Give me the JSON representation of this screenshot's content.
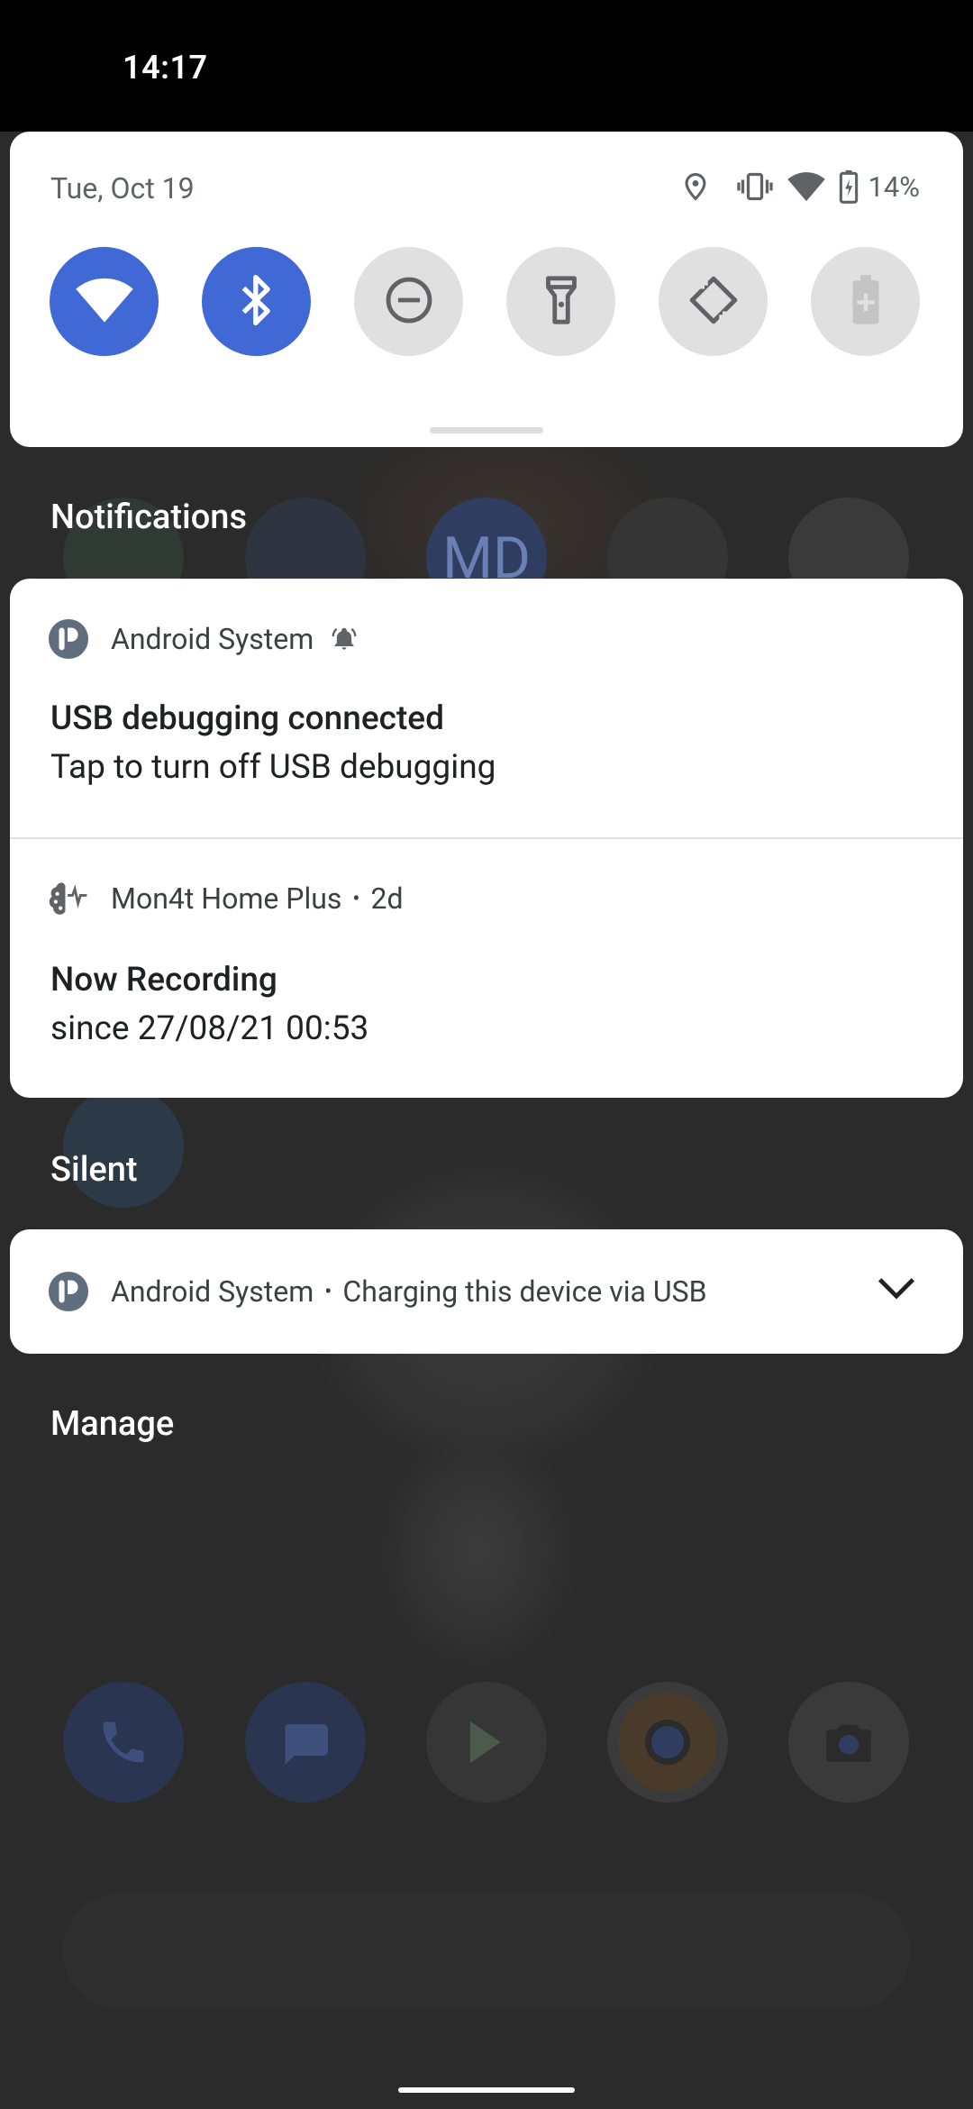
{
  "status_bar": {
    "time": "14:17"
  },
  "quick_settings": {
    "date": "Tue, Oct 19",
    "battery": "14%",
    "tiles": [
      {
        "id": "wifi",
        "icon": "wifi-icon",
        "on": true
      },
      {
        "id": "bluetooth",
        "icon": "bluetooth-icon",
        "on": true
      },
      {
        "id": "dnd",
        "icon": "do-not-disturb-icon",
        "on": false
      },
      {
        "id": "flashlight",
        "icon": "flashlight-icon",
        "on": false
      },
      {
        "id": "autorotate",
        "icon": "auto-rotate-icon",
        "on": false
      },
      {
        "id": "battery-saver",
        "icon": "battery-saver-icon",
        "on": false
      }
    ],
    "accent_color": "#4169d6"
  },
  "notifications": {
    "header": "Notifications",
    "items": [
      {
        "app": "Android System",
        "title": "USB debugging connected",
        "text": "Tap to turn off USB debugging"
      },
      {
        "app": "Mon4t Home Plus",
        "time": "2d",
        "title": "Now Recording",
        "text": "since 27/08/21 00:53"
      }
    ]
  },
  "silent": {
    "header": "Silent",
    "item": {
      "app": "Android System",
      "text": "Charging this device via USB"
    }
  },
  "manage_label": "Manage",
  "background": {
    "avatar_initials": "MD"
  }
}
